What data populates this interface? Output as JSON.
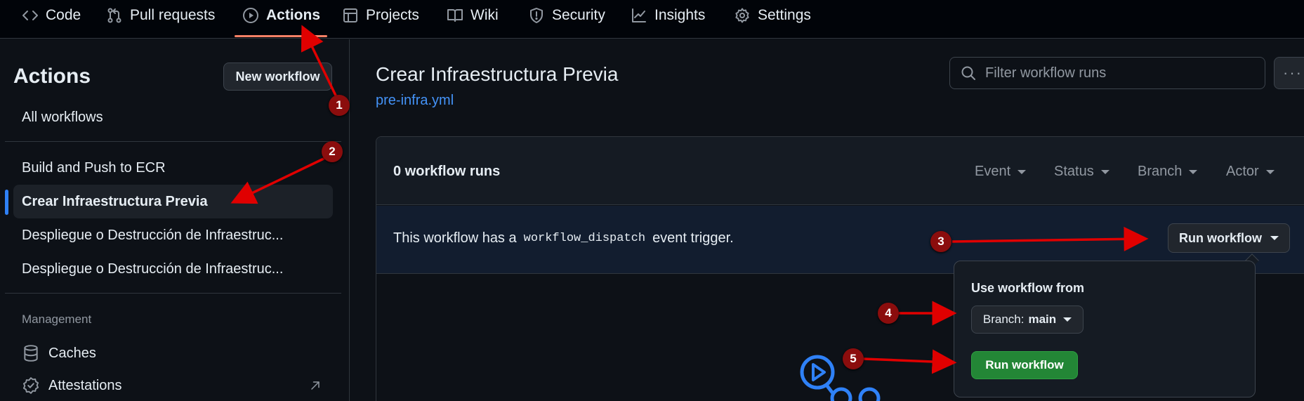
{
  "nav": {
    "tabs": [
      {
        "label": "Code",
        "icon": "code-icon"
      },
      {
        "label": "Pull requests",
        "icon": "pull-request-icon"
      },
      {
        "label": "Actions",
        "icon": "play-circle-icon",
        "active": true
      },
      {
        "label": "Projects",
        "icon": "table-icon"
      },
      {
        "label": "Wiki",
        "icon": "book-icon"
      },
      {
        "label": "Security",
        "icon": "shield-icon"
      },
      {
        "label": "Insights",
        "icon": "graph-icon"
      },
      {
        "label": "Settings",
        "icon": "gear-icon"
      }
    ]
  },
  "sidebar": {
    "title": "Actions",
    "new_workflow_label": "New workflow",
    "all_workflows_label": "All workflows",
    "workflows": [
      {
        "label": "Build and Push to ECR"
      },
      {
        "label": "Crear Infraestructura Previa",
        "selected": true
      },
      {
        "label": "Despliegue o Destrucción de Infraestruc..."
      },
      {
        "label": "Despliegue o Destrucción de Infraestruc..."
      }
    ],
    "management_heading": "Management",
    "management_items": [
      {
        "label": "Caches",
        "icon": "database-icon"
      },
      {
        "label": "Attestations",
        "icon": "verified-icon",
        "trailing_icon": "arrow-up-right-icon"
      }
    ]
  },
  "main": {
    "workflow_title": "Crear Infraestructura Previa",
    "workflow_file": "pre-infra.yml",
    "filter_placeholder": "Filter workflow runs",
    "runs_count": "0 workflow runs",
    "filters": [
      "Event",
      "Status",
      "Branch",
      "Actor"
    ],
    "dispatch_prefix": "This workflow has a",
    "dispatch_code": "workflow_dispatch",
    "dispatch_suffix": "event trigger.",
    "run_workflow_label": "Run workflow"
  },
  "popover": {
    "label": "Use workflow from",
    "branch_prefix": "Branch:",
    "branch_value": "main",
    "run_button_label": "Run workflow"
  },
  "annotations": [
    "1",
    "2",
    "3",
    "4",
    "5"
  ],
  "colors": {
    "accent_underline": "#f78166",
    "link": "#4493f8",
    "primary_button": "#238636",
    "annotation": "#8b0d0d",
    "arrow": "#e00000"
  }
}
